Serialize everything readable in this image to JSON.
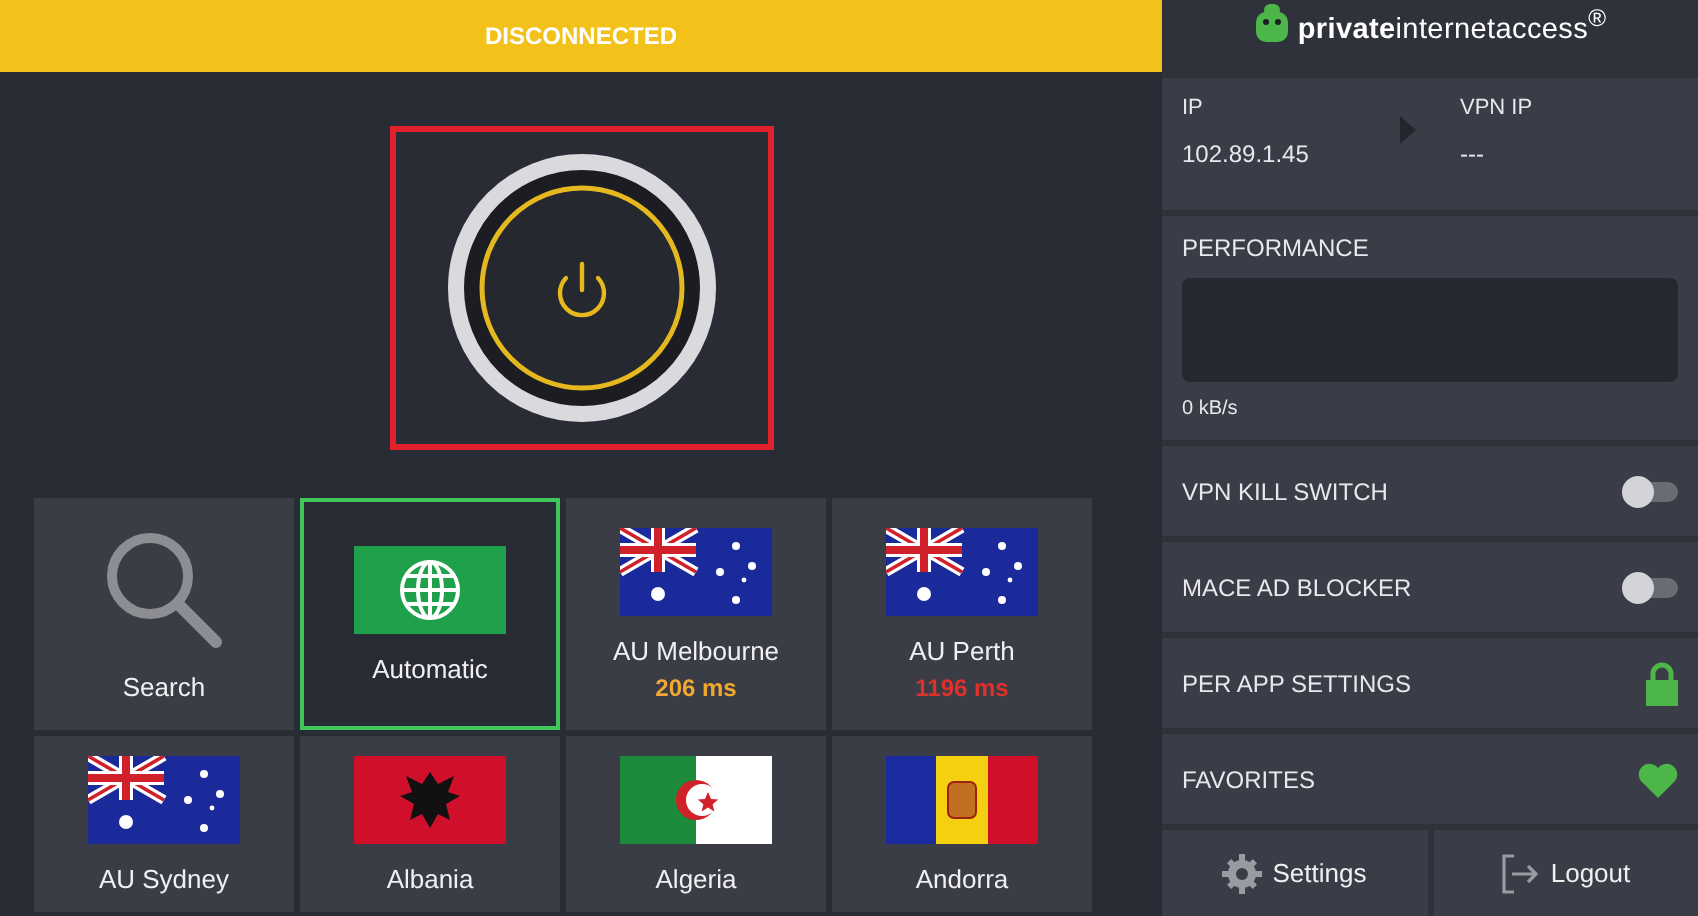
{
  "status_bar": {
    "text": "DISCONNECTED",
    "connected": false
  },
  "connect_button": {
    "highlighted": true
  },
  "logo": {
    "text": "**private**internetaccess$^{®}$"
  },
  "ip_panel": {
    "ip_label": "IP",
    "ip_value": "102.89.1.45",
    "vpn_ip_label": "VPN IP",
    "vpn_ip_value": "---"
  },
  "performance": {
    "title": "PERFORMANCE",
    "speed": "0 kB/s"
  },
  "settings_rows": [
    {
      "kind": "toggle",
      "label": "VPN KILL SWITCH",
      "on": false
    },
    {
      "kind": "toggle",
      "label": "MACE AD BLOCKER",
      "on": false
    },
    {
      "kind": "lock",
      "label": "PER APP SETTINGS"
    },
    {
      "kind": "heart",
      "label": "FAVORITES"
    }
  ],
  "footer_buttons": [
    {
      "kind": "settings",
      "label": "Settings"
    },
    {
      "kind": "logout",
      "label": "Logout"
    }
  ],
  "regions": [
    {
      "kind": "search",
      "label": "Search",
      "selected": false
    },
    {
      "kind": "automatic",
      "label": "Automatic",
      "selected": true
    },
    {
      "kind": "au",
      "label": "AU Melbourne",
      "latency": "206 ms",
      "color": "#f0a830",
      "selected": false
    },
    {
      "kind": "au",
      "label": "AU Perth",
      "latency": "1196 ms",
      "color": "#e0302a",
      "selected": false
    },
    {
      "kind": "au",
      "label": "AU Sydney",
      "selected": false
    },
    {
      "kind": "albania",
      "label": "Albania",
      "selected": false
    },
    {
      "kind": "algeria",
      "label": "Algeria",
      "selected": false
    },
    {
      "kind": "andorra",
      "label": "Andorra",
      "selected": false
    }
  ]
}
